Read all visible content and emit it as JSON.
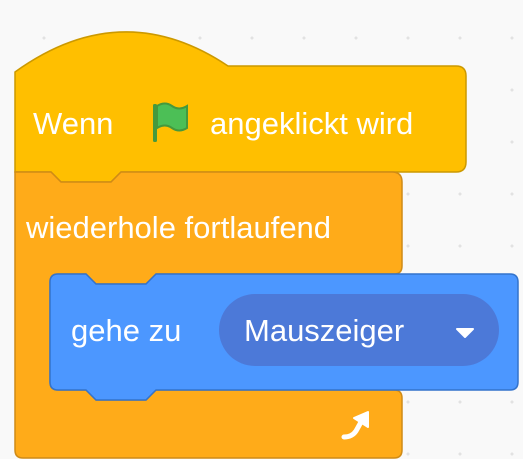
{
  "blocks": {
    "hat": {
      "text_before": "Wenn",
      "icon": "green-flag-icon",
      "text_after": "angeklickt wird",
      "color": "#ffbf00"
    },
    "forever": {
      "label": "wiederhole fortlaufend",
      "icon": "repeat-arrow-icon",
      "color": "#ffab19"
    },
    "goto": {
      "label": "gehe zu",
      "menu_value": "Mauszeiger",
      "color": "#4c97ff",
      "menu_color": "#4c79d8"
    }
  }
}
